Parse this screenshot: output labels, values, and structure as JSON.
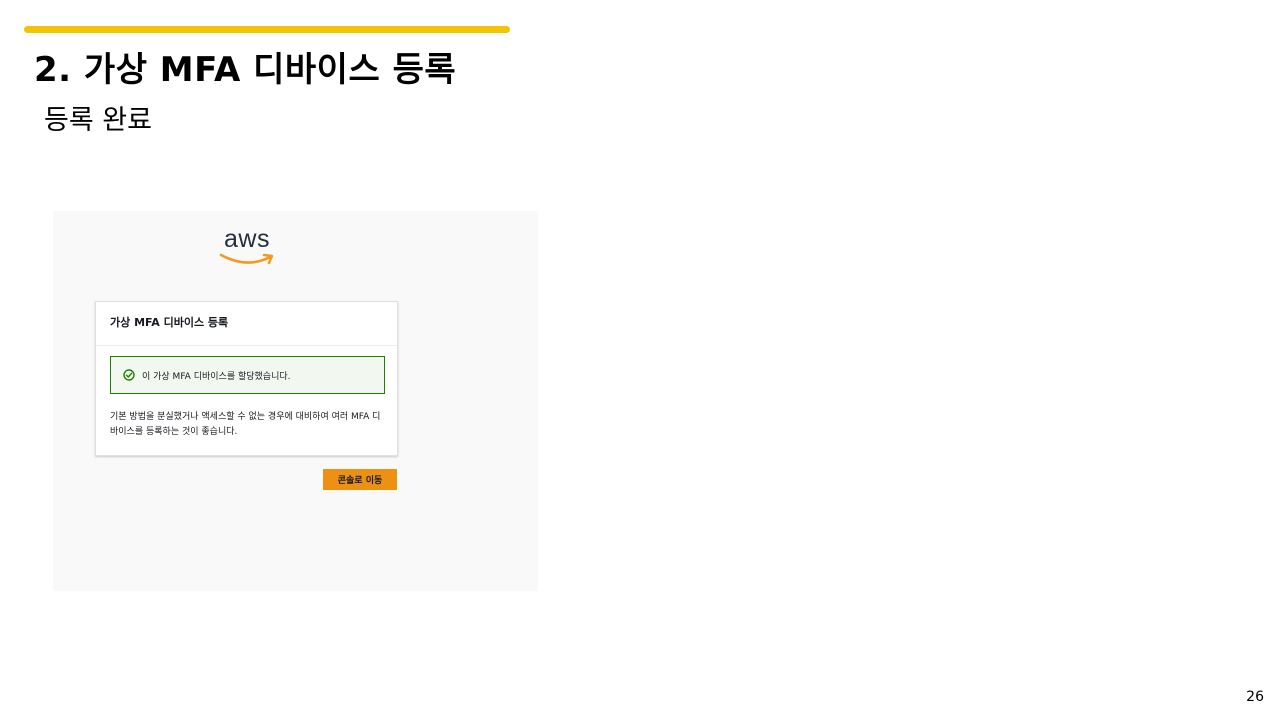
{
  "slide": {
    "title": "2. 가상 MFA 디바이스 등록",
    "subtitle": "등록 완료",
    "page_number": "26",
    "accent_color": "#f5c400"
  },
  "screenshot": {
    "logo": {
      "text": "aws",
      "smile_color": "#f29a1d"
    },
    "card": {
      "title": "가상 MFA 디바이스 등록",
      "alert": {
        "icon": "check-circle-icon",
        "text": "이 가상 MFA 디바이스를 할당했습니다.",
        "color": "#1d8102"
      },
      "body_line1": "기본 방법을 분실했거나 액세스할 수 없는 경우에 대비하여 여러 MFA 디",
      "body_line2": "바이스를 등록하는 것이 좋습니다."
    },
    "console_button": {
      "label": "콘솔로 이동",
      "color": "#ec9112"
    }
  }
}
